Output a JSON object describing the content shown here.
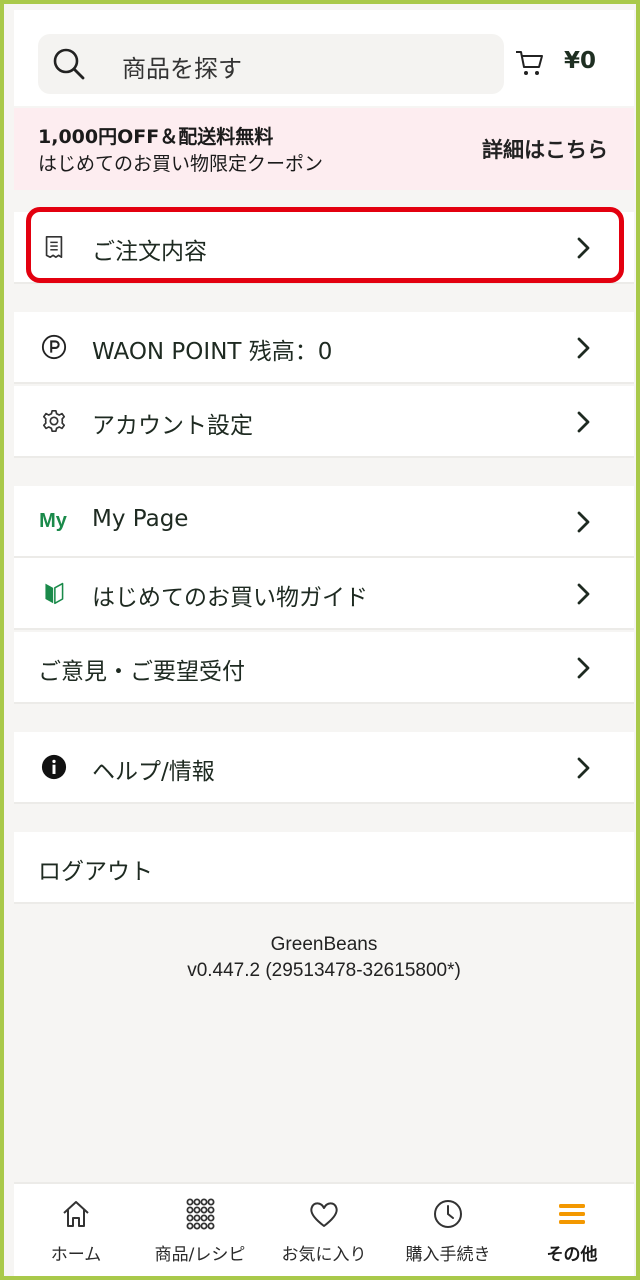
{
  "header": {
    "search_placeholder": "商品を探す",
    "cart_total": "¥0"
  },
  "coupon": {
    "line1": "1,000円OFF＆配送料無料",
    "line2": "はじめてのお買い物限定クーポン",
    "link": "詳細はこちら"
  },
  "menu": {
    "orders": "ご注文内容",
    "waon": "WAON POINT 残高：0",
    "account": "アカウント設定",
    "mypage_icon": "My",
    "mypage": "My Page",
    "guide": "はじめてのお買い物ガイド",
    "feedback": "ご意見・ご要望受付",
    "help": "ヘルプ/情報",
    "logout": "ログアウト"
  },
  "version": {
    "app": "GreenBeans",
    "number": "v0.447.2 (29513478-32615800*)"
  },
  "nav": {
    "items": [
      {
        "label": "ホーム",
        "icon": "home-icon"
      },
      {
        "label": "商品/レシピ",
        "icon": "grid-icon"
      },
      {
        "label": "お気に入り",
        "icon": "heart-icon"
      },
      {
        "label": "購入手続き",
        "icon": "clock-icon"
      },
      {
        "label": "その他",
        "icon": "menu-icon",
        "active": true
      }
    ]
  },
  "colors": {
    "accent_green": "#1a8a4a",
    "highlight_red": "#e3000f",
    "active_orange": "#f39800",
    "frame_green": "#a9c94a"
  }
}
